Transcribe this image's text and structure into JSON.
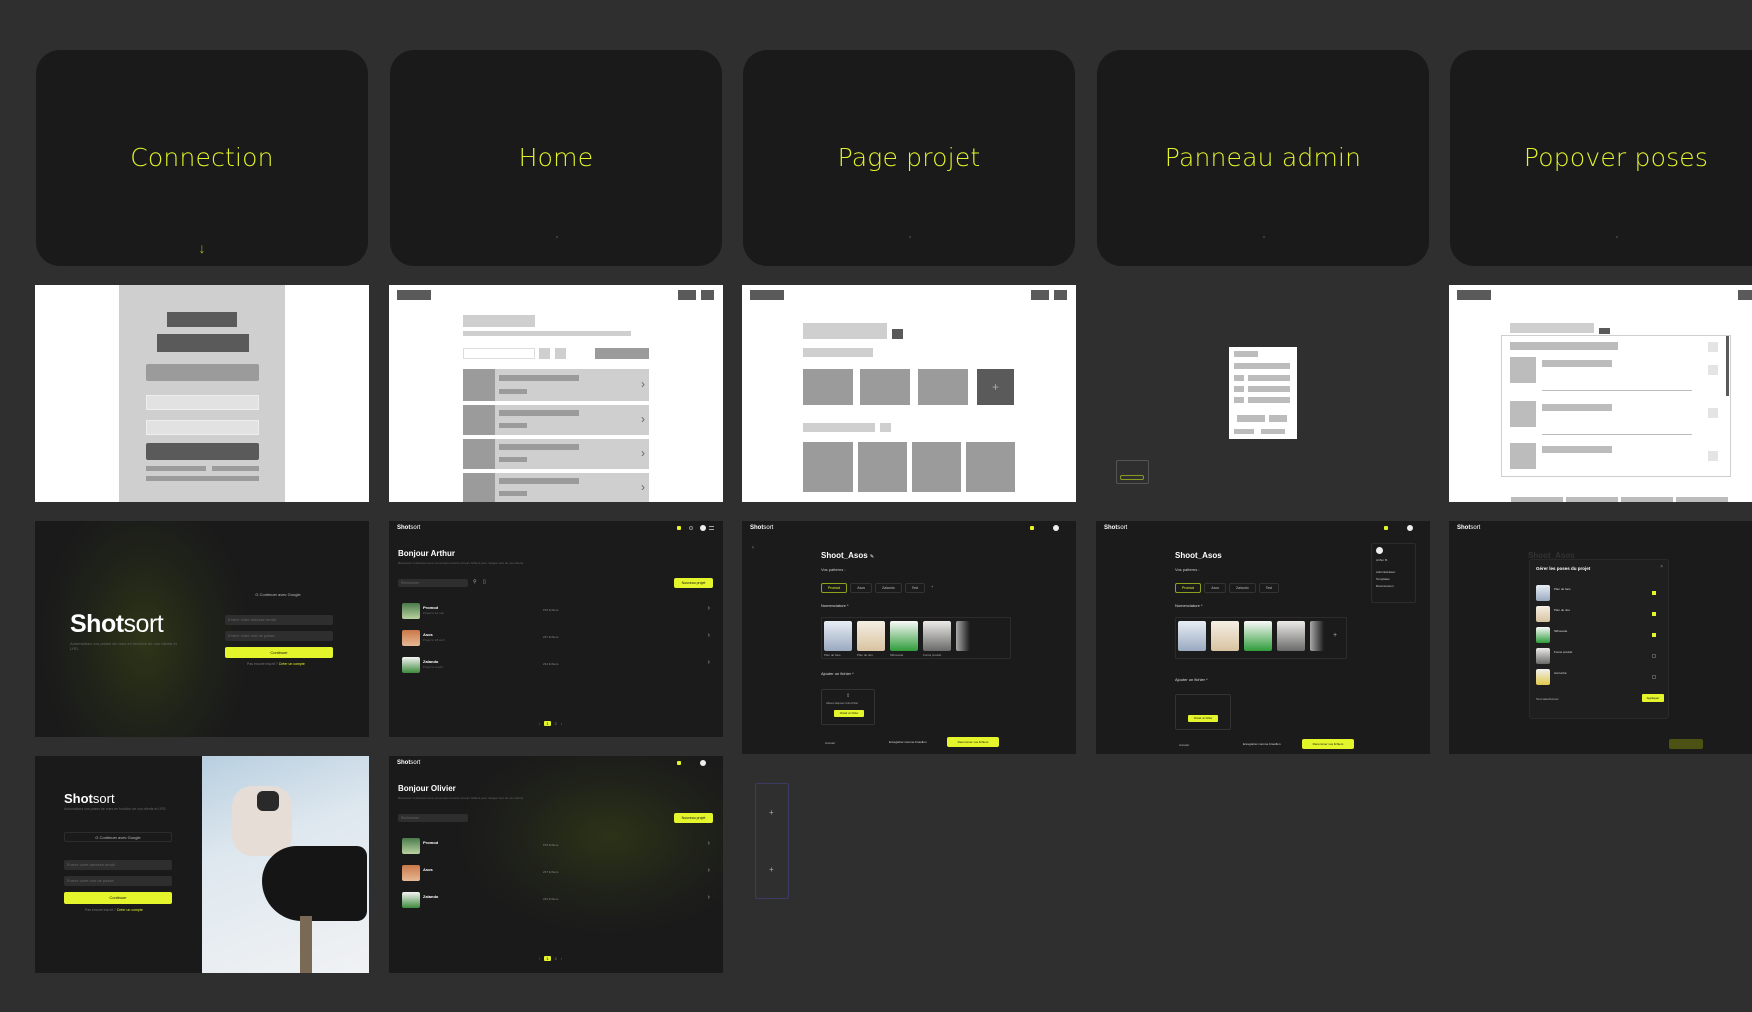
{
  "sections": [
    {
      "title": "Connection"
    },
    {
      "title": "Home"
    },
    {
      "title": "Page projet"
    },
    {
      "title": "Panneau admin"
    },
    {
      "title": "Popover poses"
    }
  ],
  "icons": {
    "arrow_down": "↓",
    "chevron": "›",
    "plus": "+",
    "pencil": "✎"
  },
  "brand": {
    "bold": "Shot",
    "light": "sort"
  },
  "login": {
    "google_label": "Continuer avec Google",
    "email_placeholder": "Entrez votre adresse email",
    "password_placeholder": "Entrez votre mot de passe",
    "continue_label": "Continuer",
    "forgot_text": "Pas encore inscrit ?",
    "create_label": "Créer un compte",
    "tagline": "Automatisez vos prises de vues en fonction de vos clients et LRD."
  },
  "home_a": {
    "greeting": "Bonjour Arthur",
    "subtitle": "Retrouvez ci-dessous tous vos projets récents et leurs fichiers pour intégrer leur de vos clients.",
    "search_placeholder": "Rechercher",
    "new_project": "Nouveau projet",
    "projects": [
      {
        "name": "Promod",
        "meta": "Projet le 12 mai",
        "count": "678 fichiers"
      },
      {
        "name": "Asos",
        "meta": "Projet le 18 avril",
        "count": "237 fichiers"
      },
      {
        "name": "Zalando",
        "meta": "Projet le 2 avril",
        "count": "234 fichiers"
      }
    ]
  },
  "home_b": {
    "greeting": "Bonjour Olivier",
    "projects": [
      {
        "name": "Promod",
        "meta": "Projet le 12 mai",
        "count": "678 fichiers"
      },
      {
        "name": "Asos",
        "meta": "Projet le 18 avril",
        "count": "237 fichiers"
      },
      {
        "name": "Zalando",
        "meta": "Projet le 2 avril",
        "count": "234 fichiers"
      }
    ]
  },
  "project": {
    "title": "Shoot_Asos",
    "patterns_label": "Vos patterns :",
    "tabs": [
      "Promod",
      "Asos",
      "Zalando",
      "Test"
    ],
    "nomenclature_label": "Nomenclature *",
    "poses": [
      "Plan de face",
      "Plan de dos",
      "Silhouette",
      "Focus produit",
      "Focus"
    ],
    "add_file_label": "Ajouter un fichier *",
    "drop_text": "Glissez-déposez votre fichier",
    "choose_label": "Choisir un fichier",
    "cancel_label": "Annuler",
    "save_label": "Enregistrer comme brouillon",
    "rename_label": "Renommer vos fichiers"
  },
  "admin": {
    "user": "Arthur B.",
    "menu": [
      "Administrateur",
      "Templates",
      "Déconnexion"
    ]
  },
  "popover": {
    "title": "Gérer les poses du projet",
    "items": [
      "Plan de face",
      "Plan de dos",
      "Silhouette",
      "Focus produit",
      "Accroché"
    ],
    "checked": [
      true,
      true,
      true,
      false,
      false
    ],
    "select_all": "Tout sélectionner",
    "apply": "Appliquer"
  },
  "pagination": {
    "current": "1",
    "next": "2"
  }
}
